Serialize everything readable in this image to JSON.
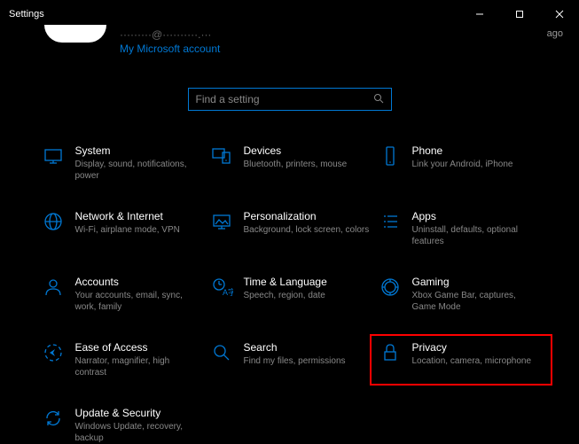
{
  "window": {
    "title": "Settings"
  },
  "header": {
    "email": "·········@··········.···",
    "ms_account_link": "My Microsoft account",
    "ago_label": "ago"
  },
  "search": {
    "placeholder": "Find a setting"
  },
  "tiles": [
    {
      "key": "system",
      "title": "System",
      "desc": "Display, sound, notifications, power"
    },
    {
      "key": "devices",
      "title": "Devices",
      "desc": "Bluetooth, printers, mouse"
    },
    {
      "key": "phone",
      "title": "Phone",
      "desc": "Link your Android, iPhone"
    },
    {
      "key": "network",
      "title": "Network & Internet",
      "desc": "Wi-Fi, airplane mode, VPN"
    },
    {
      "key": "personalization",
      "title": "Personalization",
      "desc": "Background, lock screen, colors"
    },
    {
      "key": "apps",
      "title": "Apps",
      "desc": "Uninstall, defaults, optional features"
    },
    {
      "key": "accounts",
      "title": "Accounts",
      "desc": "Your accounts, email, sync, work, family"
    },
    {
      "key": "time",
      "title": "Time & Language",
      "desc": "Speech, region, date"
    },
    {
      "key": "gaming",
      "title": "Gaming",
      "desc": "Xbox Game Bar, captures, Game Mode"
    },
    {
      "key": "ease",
      "title": "Ease of Access",
      "desc": "Narrator, magnifier, high contrast"
    },
    {
      "key": "search_tile",
      "title": "Search",
      "desc": "Find my files, permissions"
    },
    {
      "key": "privacy",
      "title": "Privacy",
      "desc": "Location, camera, microphone"
    },
    {
      "key": "update",
      "title": "Update & Security",
      "desc": "Windows Update, recovery, backup"
    }
  ],
  "highlight": {
    "tile_key": "privacy"
  }
}
